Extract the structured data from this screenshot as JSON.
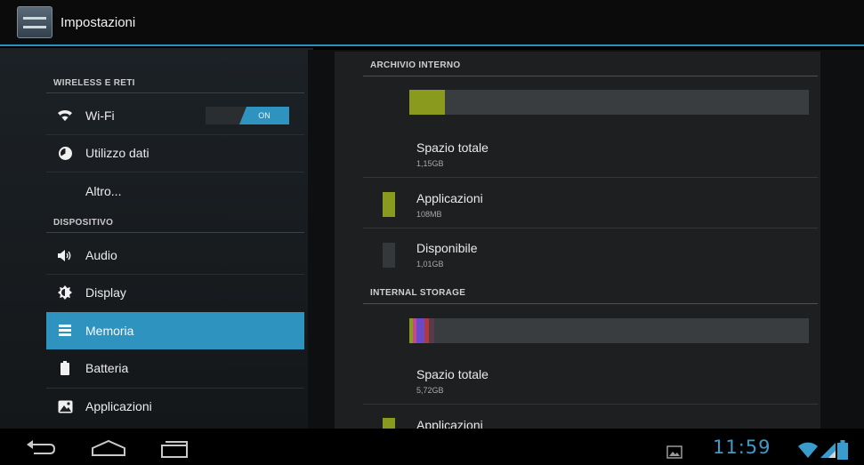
{
  "action_bar": {
    "title": "Impostazioni",
    "app_icon": "settings-icon"
  },
  "sidebar": {
    "sections": [
      {
        "header": "WIRELESS E RETI"
      },
      {
        "header": "DISPOSITIVO"
      }
    ],
    "items": [
      {
        "label": "Wi-Fi",
        "icon": "wifi-icon"
      },
      {
        "label": "Utilizzo dati",
        "icon": "data-usage-icon"
      },
      {
        "label": "Altro..."
      },
      {
        "label": "Audio",
        "icon": "speaker-icon"
      },
      {
        "label": "Display",
        "icon": "brightness-icon"
      },
      {
        "label": "Memoria",
        "icon": "storage-icon",
        "selected": true
      },
      {
        "label": "Batteria",
        "icon": "battery-icon"
      },
      {
        "label": "Applicazioni",
        "icon": "apps-icon"
      }
    ],
    "wifi_toggle": {
      "state": "ON"
    }
  },
  "storage": {
    "internal": {
      "header": "ARCHIVIO INTERNO",
      "usage_fraction": 0.09,
      "rows": [
        {
          "title": "Spazio totale",
          "value": "1,15GB"
        },
        {
          "title": "Applicazioni",
          "value": "108MB",
          "color": "#8a9a1e"
        },
        {
          "title": "Disponibile",
          "value": "1,01GB",
          "color": "#34383b"
        }
      ]
    },
    "internal_storage": {
      "header": "INTERNAL STORAGE",
      "rows": [
        {
          "title": "Spazio totale",
          "value": "5,72GB"
        },
        {
          "title": "Applicazioni",
          "color": "#8a9a1e"
        }
      ]
    }
  },
  "status_bar": {
    "time": "11:59"
  },
  "colors": {
    "accent": "#2f93bf",
    "apps_green": "#8a9a1e"
  }
}
